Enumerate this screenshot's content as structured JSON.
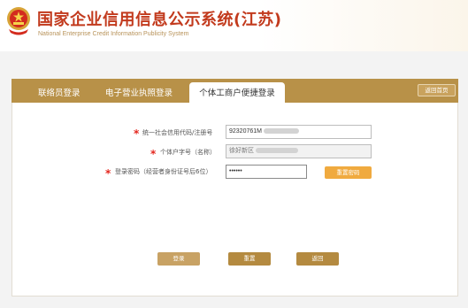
{
  "header": {
    "title": "国家企业信用信息公示系统(江苏)",
    "subtitle": "National Enterprise Credit Information Publicity System",
    "emblem_icon": "national-emblem-icon"
  },
  "tabs": {
    "items": [
      {
        "label": "联络员登录"
      },
      {
        "label": "电子营业执照登录"
      },
      {
        "label": "个体工商户便捷登录"
      }
    ],
    "active": "个体工商户便捷登录",
    "back_home_label": "返回首页"
  },
  "form": {
    "credit_code": {
      "label": "统一社会信用代码/注册号",
      "value": "92320761M"
    },
    "shop_name": {
      "label": "个体户字号（名称）",
      "value": "徐好新区"
    },
    "password": {
      "label": "登录密码（经营者身份证号后6位）",
      "value": "••••••"
    },
    "required_mark": "*",
    "reset_password_label": "重置密码"
  },
  "actions": {
    "login_label": "登录",
    "reset_label": "重置",
    "back_label": "返回"
  },
  "colors": {
    "brand_red": "#c23a1d",
    "tab_bar": "#b89148",
    "button_gold": "#b48a40",
    "reset_password_orange": "#f0aa3f",
    "required_red": "#e4261e"
  }
}
